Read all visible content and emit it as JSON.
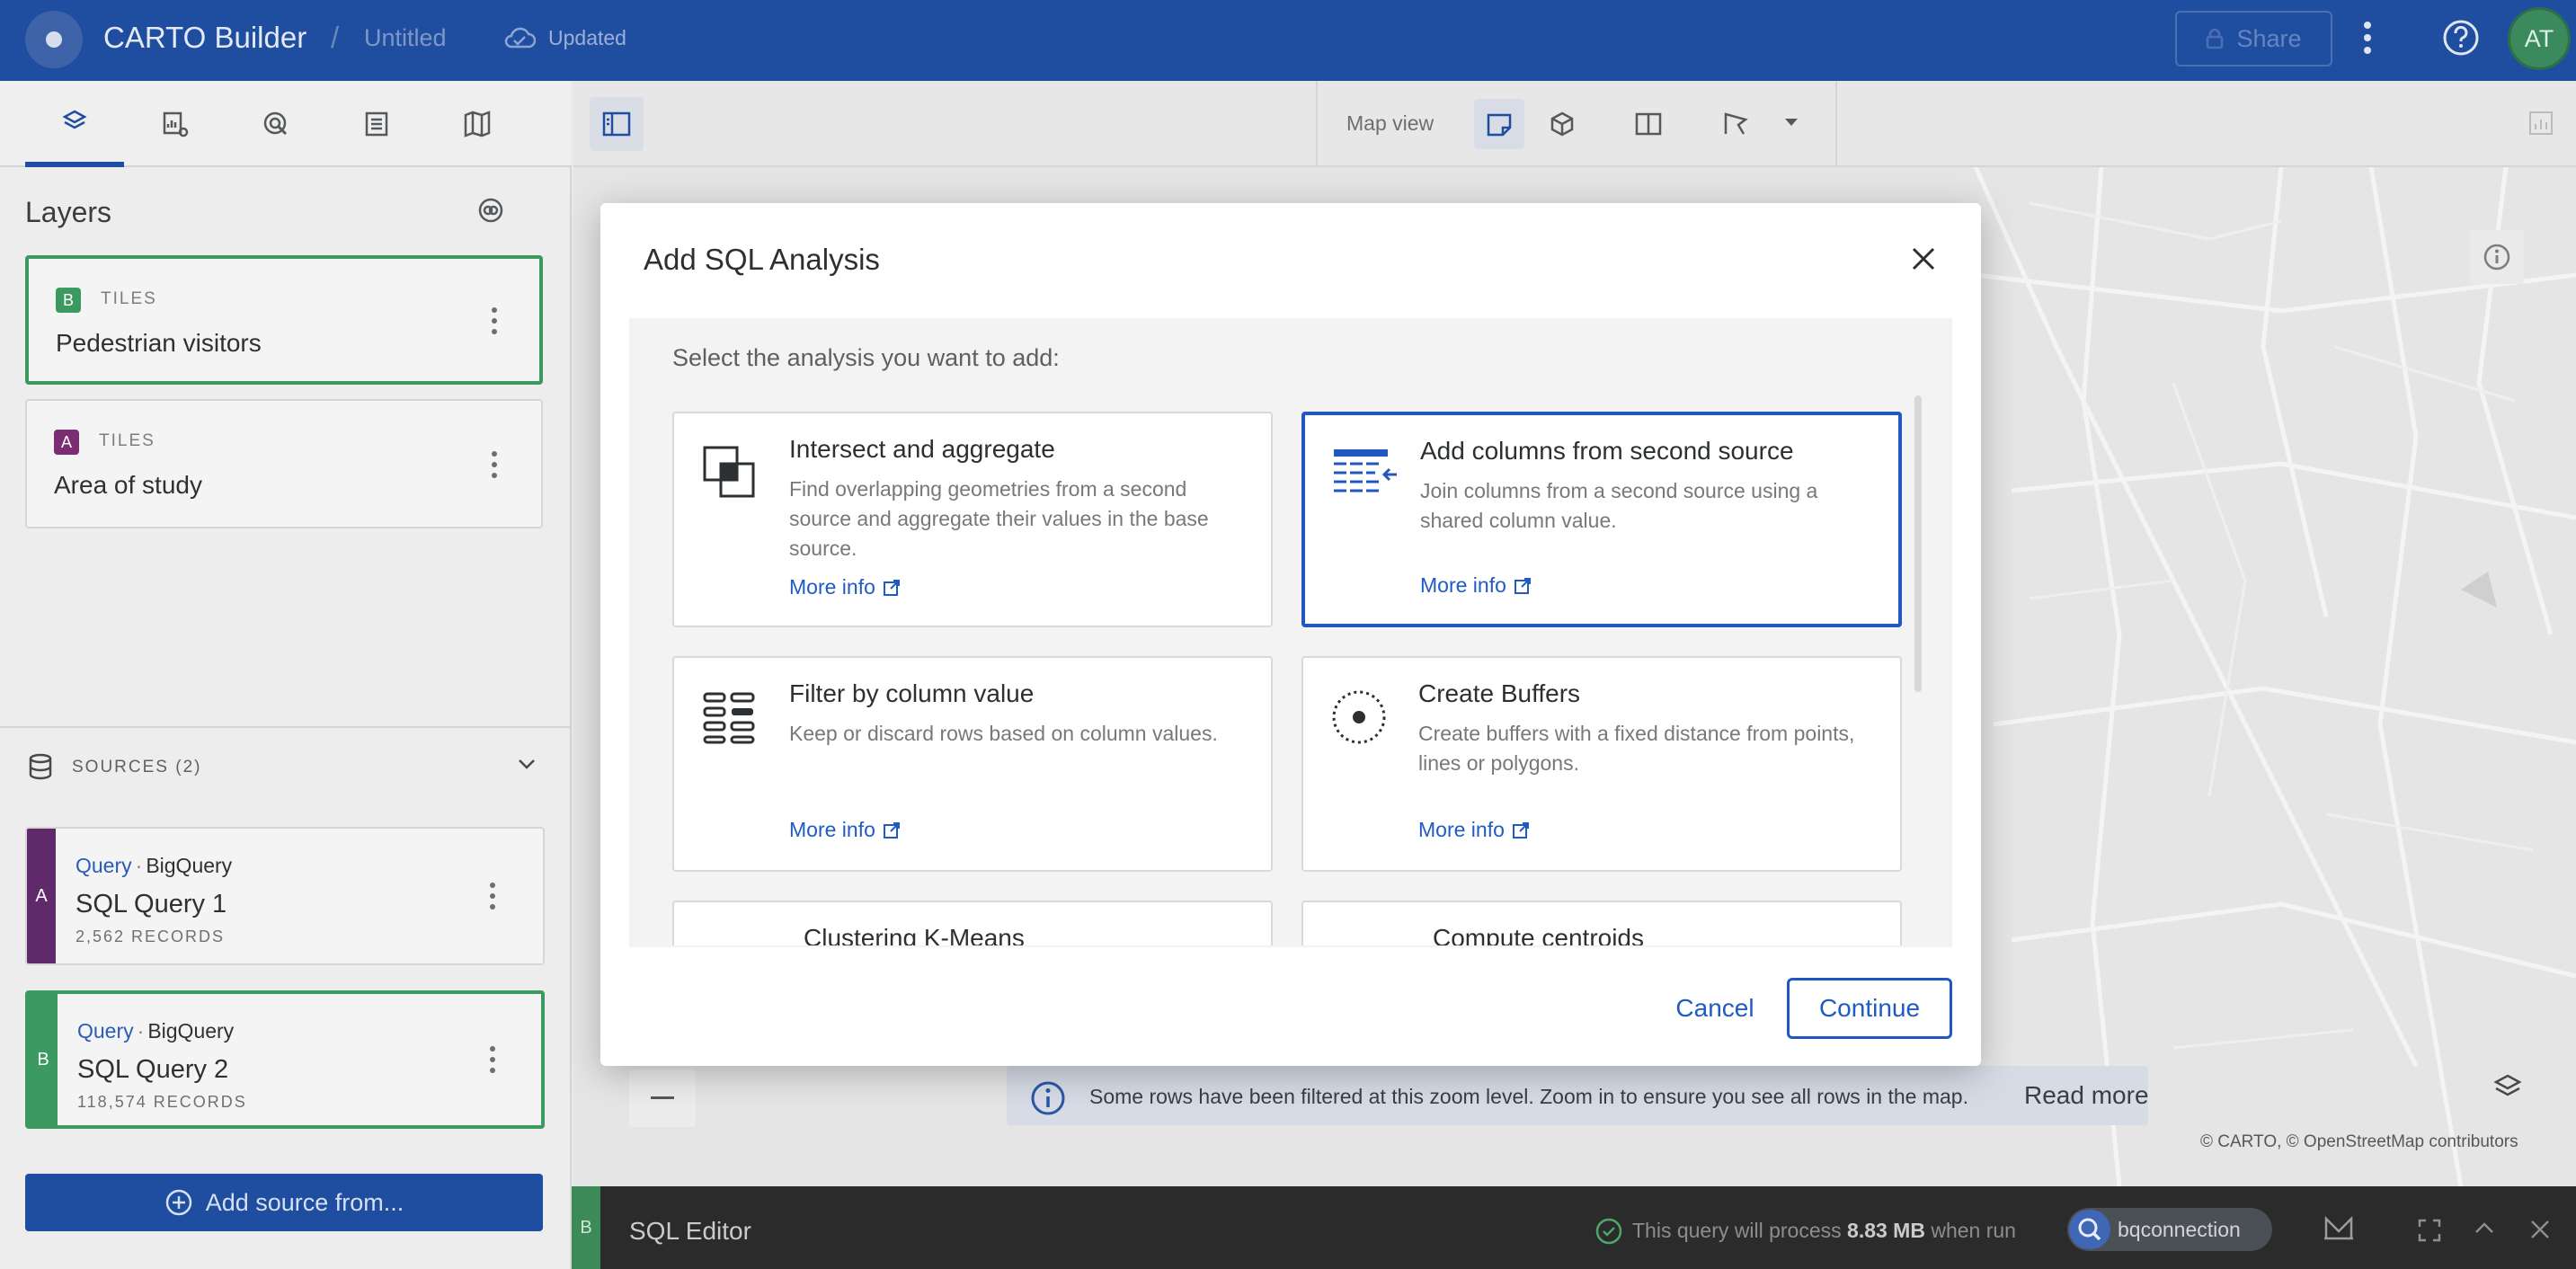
{
  "app": {
    "title": "CARTO Builder",
    "separator": "/",
    "map_name": "Untitled",
    "save_status": "Updated",
    "share_label": "Share",
    "user_initials": "AT",
    "brand_color": "#1f4ea0"
  },
  "left_tabs": [
    {
      "icon": "layers-icon",
      "active": true
    },
    {
      "icon": "widgets-icon",
      "active": false
    },
    {
      "icon": "interactions-icon",
      "active": false
    },
    {
      "icon": "legend-icon",
      "active": false
    },
    {
      "icon": "basemap-icon",
      "active": false
    }
  ],
  "layers": {
    "title": "Layers",
    "items": [
      {
        "badge": "B",
        "badge_color": "#3c9a60",
        "type": "TILES",
        "name": "Pedestrian visitors",
        "selected": true
      },
      {
        "badge": "A",
        "badge_color": "#7b2d74",
        "type": "TILES",
        "name": "Area of study",
        "selected": false
      }
    ]
  },
  "sources": {
    "label": "SOURCES (2)",
    "items": [
      {
        "letter": "A",
        "color": "#5f2a6a",
        "kind": "Query",
        "provider": "BigQuery",
        "name": "SQL Query 1",
        "records": "2,562 RECORDS",
        "selected": false
      },
      {
        "letter": "B",
        "color": "#3c9a60",
        "kind": "Query",
        "provider": "BigQuery",
        "name": "SQL Query 2",
        "records": "118,574 RECORDS",
        "selected": true
      }
    ],
    "add_label": "Add source from..."
  },
  "map_toolbar": {
    "map_view_label": "Map view"
  },
  "map_notice": {
    "text": "Some rows have been filtered at this zoom level. Zoom in to ensure you see all rows in the map.",
    "link": "Read more"
  },
  "attribution": "© CARTO, © OpenStreetMap contributors",
  "sql_editor": {
    "badge": "B",
    "title": "SQL Editor",
    "process_prefix": "This query will process",
    "process_amount": "8.83 MB",
    "process_suffix": "when run",
    "connection": "bqconnection"
  },
  "modal": {
    "title": "Add SQL Analysis",
    "instruction": "Select the analysis you want to add:",
    "more_info": "More info",
    "options": [
      {
        "title": "Intersect and aggregate",
        "description": "Find overlapping geometries from a second source and aggregate their values in the base source.",
        "icon": "intersect-icon",
        "selected": false
      },
      {
        "title": "Add columns from second source",
        "description": "Join columns from a second source using a shared column value.",
        "icon": "add-columns-icon",
        "selected": true
      },
      {
        "title": "Filter by column value",
        "description": "Keep or discard rows based on column values.",
        "icon": "filter-icon",
        "selected": false
      },
      {
        "title": "Create Buffers",
        "description": "Create buffers with a fixed distance from points, lines or polygons.",
        "icon": "buffer-icon",
        "selected": false
      },
      {
        "title": "Clustering K-Means",
        "description": "",
        "icon": "cluster-icon",
        "selected": false
      },
      {
        "title": "Compute centroids",
        "description": "",
        "icon": "centroid-icon",
        "selected": false
      }
    ],
    "cancel_label": "Cancel",
    "continue_label": "Continue"
  }
}
